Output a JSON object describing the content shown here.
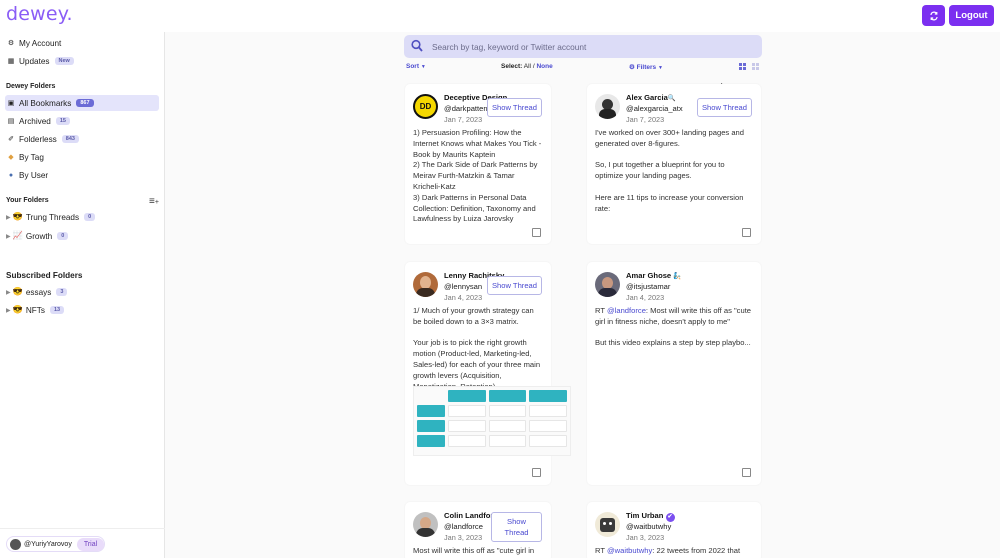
{
  "app": {
    "logo": "dewey.",
    "logout_label": "Logout"
  },
  "colors": {
    "accent": "#7b2ff0",
    "link": "#4a4ad0",
    "badge_bg": "#dcdcf7",
    "active_bg": "#e4e4fb",
    "teal": "#2fb3c0"
  },
  "sidebar": {
    "my_account": "My Account",
    "updates": "Updates",
    "updates_badge": "New",
    "dewey_folders_title": "Dewey Folders",
    "items": [
      {
        "label": "All Bookmarks",
        "count": "867",
        "icon": "bookmark-icon"
      },
      {
        "label": "Archived",
        "count": "15",
        "icon": "archive-icon"
      },
      {
        "label": "Folderless",
        "count": "843",
        "icon": "folderless-icon"
      },
      {
        "label": "By Tag",
        "icon": "tag-icon"
      },
      {
        "label": "By User",
        "icon": "user-icon"
      }
    ],
    "your_folders_title": "Your Folders",
    "your_folders": [
      {
        "label": "Trung Threads",
        "count": "0",
        "emoji": "😎"
      },
      {
        "label": "Growth",
        "count": "0",
        "emoji": "📈"
      }
    ],
    "subscribed_title": "Subscribed Folders",
    "subscribed": [
      {
        "label": "essays",
        "count": "3",
        "emoji": "😎"
      },
      {
        "label": "NFTs",
        "count": "13",
        "emoji": "😎"
      }
    ],
    "user": {
      "handle": "@YuriyYarovoy",
      "plan": "Trial"
    }
  },
  "search": {
    "placeholder": "Search by tag, keyword or Twitter account"
  },
  "toolbar": {
    "sort": "Sort",
    "select_label": "Select:",
    "select_all": "All",
    "select_sep": "/",
    "select_none": "None",
    "filters": "Filters"
  },
  "cards": [
    {
      "name": "Deceptive Design",
      "handle": "@darkpatterns",
      "date": "Jan 7, 2023",
      "show_thread": "Show Thread",
      "text": "1) Persuasion Profiling: How the Internet Knows what Makes You Tick - Book by Maurits Kaptein\n2) The Dark Side of Dark Patterns by Meirav Furth-Matzkin & Tamar Kricheli-Katz\n3) Dark Patterns in Personal Data Collection: Definition, Taxonomy and Lawfulness by Luiza Jarovsky"
    },
    {
      "name": "Alex Garcia",
      "name_emoji": "🔍",
      "handle": "@alexgarcia_atx",
      "date": "Jan 7, 2023",
      "show_thread": "Show Thread",
      "text": "I've worked on over 300+ landing pages and generated over 8-figures.\n\nSo, I put together a blueprint for you to optimize your landing pages.\n\nHere are 11 tips to increase your conversion rate:"
    },
    {
      "name": "Lenny Rachitsky",
      "handle": "@lennysan",
      "date": "Jan 4, 2023",
      "show_thread": "Show Thread",
      "text": "1/ Much of your growth strategy can be boiled down to a 3×3 matrix.\n\nYour job is to pick the right growth motion (Product-led, Marketing-led, Sales-led) for each of your three main growth levers (Acquisition, Monetization, Retention)."
    },
    {
      "name": "Amar Ghose",
      "name_emoji": "🧞",
      "handle": "@itsjustamar",
      "date": "Jan 4, 2023",
      "text_prefix": "RT ",
      "mention": "@landforce",
      "text": ": Most will write this off as \"cute girl in fitness niche, doesn't apply to me\"\n\nBut this video explains a step by step playbo..."
    },
    {
      "name": "Colin Landforce",
      "name_emoji": "⚒️",
      "handle": "@landforce",
      "date": "Jan 3, 2023",
      "show_thread": "Show Thread",
      "text": "Most will write this off as \"cute girl in fitness"
    },
    {
      "name": "Tim Urban",
      "name_emoji": "✔",
      "handle": "@waitbutwhy",
      "date": "Jan 3, 2023",
      "text_prefix": "RT ",
      "mention": "@waitbutwhy",
      "text": ": 22 tweets from 2022 that"
    }
  ]
}
